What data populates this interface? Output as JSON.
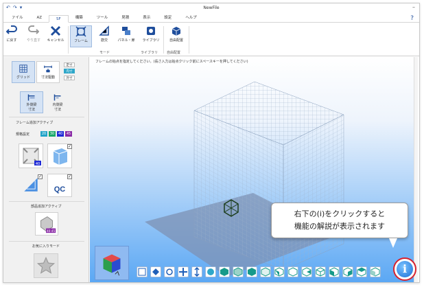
{
  "app": {
    "title": "NewFile"
  },
  "tabs": [
    {
      "label": "ァイル"
    },
    {
      "label": "AZ"
    },
    {
      "label": "SF",
      "active": true
    },
    {
      "label": "構築"
    },
    {
      "label": "ツール"
    },
    {
      "label": "見積"
    },
    {
      "label": "表示"
    },
    {
      "label": "設定"
    },
    {
      "label": "ヘルプ"
    }
  ],
  "ribbon": {
    "undo": "に戻す",
    "redo": "やり直す",
    "cancel": "キャンセル",
    "frame": "フレーム",
    "bracket": "筋交",
    "panel": "パネル・扉",
    "library": "ライブラリ",
    "auto_place": "自由配置",
    "group_mode": "モード",
    "group_library": "ライブラリ",
    "group_auto": "自由配置"
  },
  "left": {
    "grid": "グリッド",
    "dim_drive": "寸法駆動",
    "opt_fixed": "定寸",
    "opt_inner": "内寸",
    "opt_outer": "外寸",
    "outer_frame_dim": "外側梁\n寸法",
    "inner_frame_dim": "内側梁\n寸法",
    "frame_add_active": "フレーム追加アクティブ",
    "spec_label": "規格設定",
    "specs": [
      "20",
      "30",
      "40",
      "45"
    ],
    "frame_badge": "40",
    "qc_label": "QC",
    "parts_add_active": "部品追加アクティブ",
    "parts_badge": "40-45",
    "favorites": "お気に入りモード"
  },
  "viewport": {
    "hint": "フレームの始点を指定してください。(長さ入力は始点クリック前にスペースキーを押してください)"
  },
  "tooltip": {
    "line1": "右下の(i)をクリックすると",
    "line2": "機能の解説が表示されます"
  },
  "info_button": {
    "glyph": "i"
  },
  "colors": {
    "accent": "#1f4e9c",
    "viewport_bottom": "#5aa7f4",
    "highlight": "#d7212e"
  }
}
